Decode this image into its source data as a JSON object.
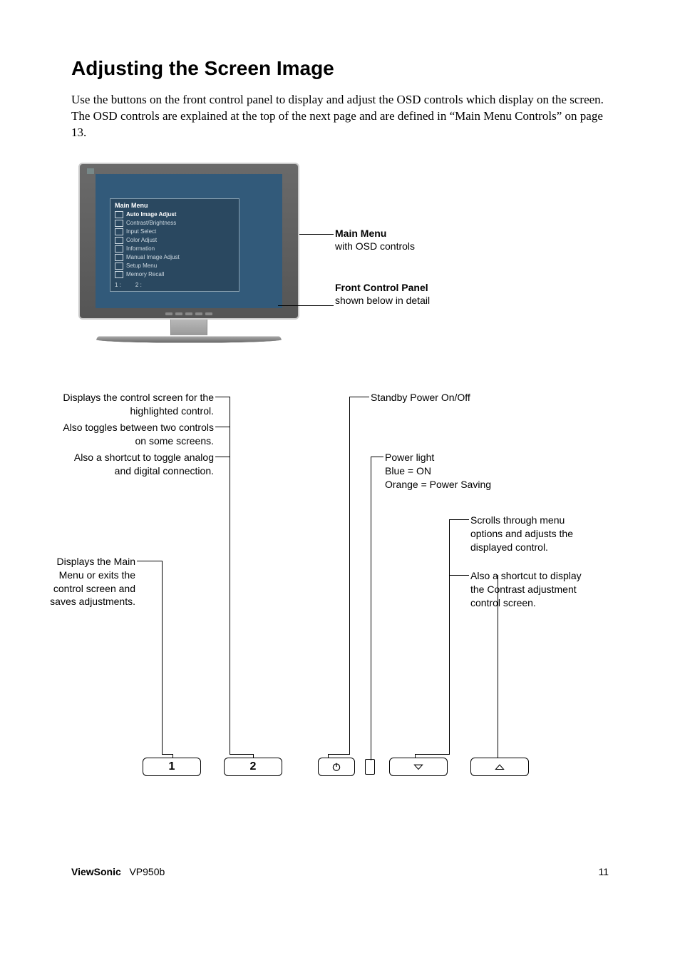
{
  "title": "Adjusting the Screen Image",
  "intro": "Use the buttons on the front control panel to display and adjust the OSD controls which display on the screen. The OSD controls are explained at the top of the next page and are defined in “Main Menu Controls” on page 13.",
  "osd": {
    "title": "Main Menu",
    "items": [
      "Auto Image Adjust",
      "Contrast/Brightness",
      "Input Select",
      "Color Adjust",
      "Information",
      "Manual Image Adjust",
      "Setup Menu",
      "Memory Recall"
    ],
    "footer1": "1 :",
    "footer2": "2 :"
  },
  "sideLabels": {
    "mainMenuTitle": "Main Menu",
    "mainMenuSub": "with OSD controls",
    "panelTitle": "Front Control Panel",
    "panelSub": "shown below in detail"
  },
  "callouts": {
    "topLeft1": "Displays the control screen for the highlighted control.",
    "topLeft2": "Also toggles between two controls on some screens.",
    "topLeft3": "Also a shortcut to toggle analog and digital connection.",
    "midLeft": "Displays the Main Menu or exits the control screen and saves adjustments.",
    "standby": "Standby Power On/Off",
    "powerLight": "Power light",
    "blueOn": "Blue = ON",
    "orange": "Orange = Power Saving",
    "scroll1": "Scrolls through menu options and adjusts the displayed control.",
    "scroll2": "Also a shortcut to display the Contrast adjustment control screen."
  },
  "buttons": {
    "b1": "1",
    "b2": "2"
  },
  "footer": {
    "brand": "ViewSonic",
    "model": "VP950b",
    "page": "11"
  }
}
